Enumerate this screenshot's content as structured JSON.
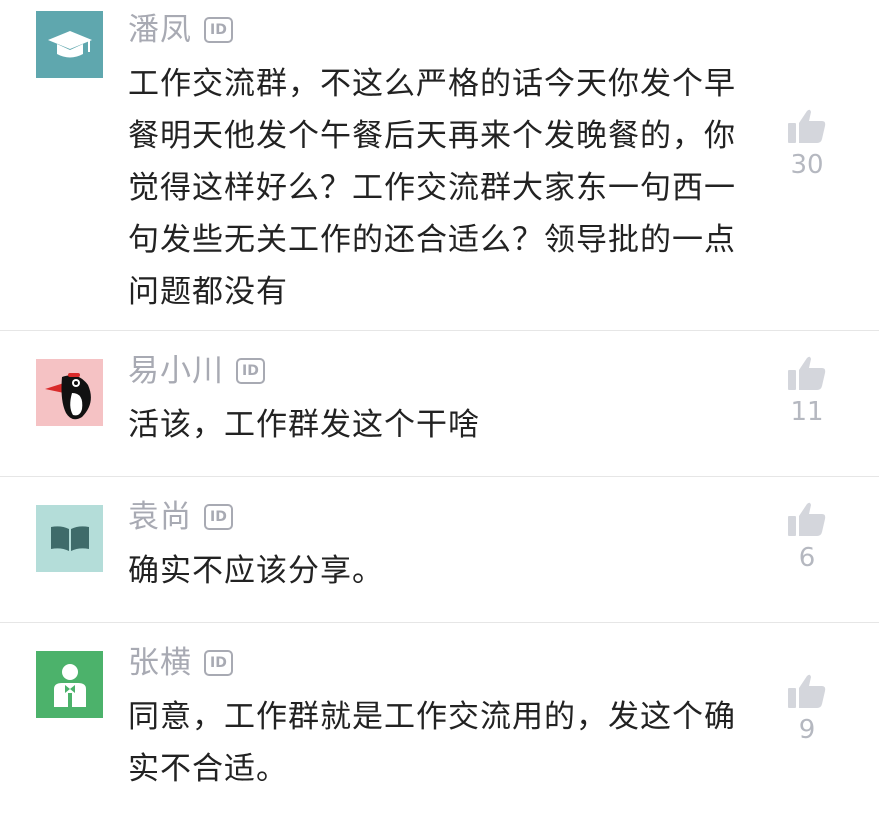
{
  "id_badge": "ID",
  "comments": [
    {
      "user": "潘凤",
      "avatar": "graduation-cap-icon",
      "avatar_bg": "#5fa7ae",
      "lines": [
        "工作交流群，不这么严格的话今天你发个早",
        "餐明天他发个午餐后天再来个发晚餐的，你",
        "觉得这样好么？工作交流群大家东一句西一",
        "句发些无关工作的还合适么？领导批的一点",
        "问题都没有"
      ],
      "likes": "30"
    },
    {
      "user": "易小川",
      "avatar": "woodpecker-icon",
      "avatar_bg": "#f5c2c4",
      "lines": [
        "活该，工作群发这个干啥"
      ],
      "likes": "11"
    },
    {
      "user": "袁尚",
      "avatar": "book-icon",
      "avatar_bg": "#b4ddd9",
      "lines": [
        "确实不应该分享。"
      ],
      "likes": "6"
    },
    {
      "user": "张横",
      "avatar": "person-icon",
      "avatar_bg": "#4cb26b",
      "lines": [
        "同意，工作群就是工作交流用的，发这个确",
        "实不合适。"
      ],
      "likes": "9"
    }
  ]
}
